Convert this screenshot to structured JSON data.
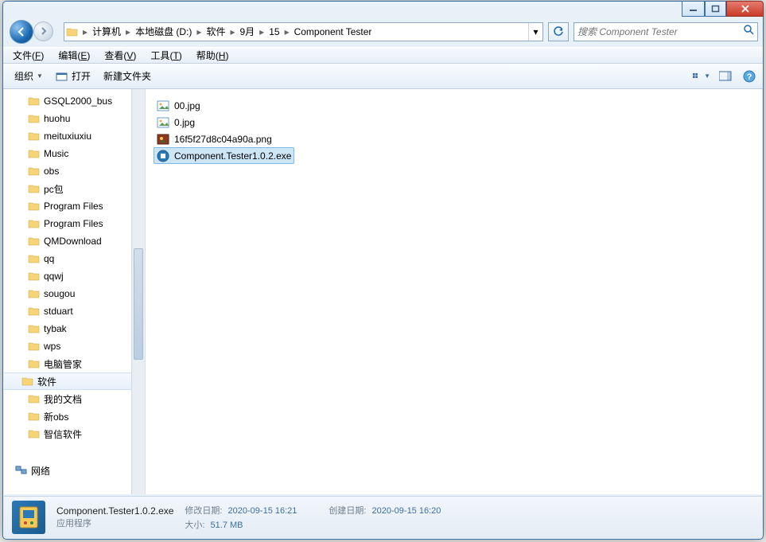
{
  "breadcrumbs": [
    "计算机",
    "本地磁盘 (D:)",
    "软件",
    "9月",
    "15",
    "Component Tester"
  ],
  "search": {
    "placeholder": "搜索 Component Tester"
  },
  "menubar": [
    {
      "label": "文件",
      "key": "F"
    },
    {
      "label": "编辑",
      "key": "E"
    },
    {
      "label": "查看",
      "key": "V"
    },
    {
      "label": "工具",
      "key": "T"
    },
    {
      "label": "帮助",
      "key": "H"
    }
  ],
  "toolbar": {
    "organize": "组织",
    "open": "打开",
    "newfolder": "新建文件夹"
  },
  "tree": [
    {
      "label": "GSQL2000_bus"
    },
    {
      "label": "huohu"
    },
    {
      "label": "meituxiuxiu"
    },
    {
      "label": "Music"
    },
    {
      "label": "obs"
    },
    {
      "label": "pc包"
    },
    {
      "label": "Program Files"
    },
    {
      "label": "Program Files"
    },
    {
      "label": "QMDownload"
    },
    {
      "label": "qq"
    },
    {
      "label": "qqwj"
    },
    {
      "label": "sougou"
    },
    {
      "label": "stduart"
    },
    {
      "label": "tybak"
    },
    {
      "label": "wps"
    },
    {
      "label": "电脑管家"
    },
    {
      "label": "软件",
      "selected": true
    },
    {
      "label": "我的文档"
    },
    {
      "label": "新obs"
    },
    {
      "label": "智信软件"
    }
  ],
  "network_label": "网络",
  "files": [
    {
      "name": "00.jpg",
      "type": "image"
    },
    {
      "name": "0.jpg",
      "type": "image"
    },
    {
      "name": "16f5f27d8c04a90a.png",
      "type": "png"
    },
    {
      "name": "Component.Tester1.0.2.exe",
      "type": "exe",
      "selected": true
    }
  ],
  "details": {
    "name": "Component.Tester1.0.2.exe",
    "type": "应用程序",
    "mod_label": "修改日期:",
    "mod_value": "2020-09-15 16:21",
    "create_label": "创建日期:",
    "create_value": "2020-09-15 16:20",
    "size_label": "大小:",
    "size_value": "51.7 MB"
  }
}
